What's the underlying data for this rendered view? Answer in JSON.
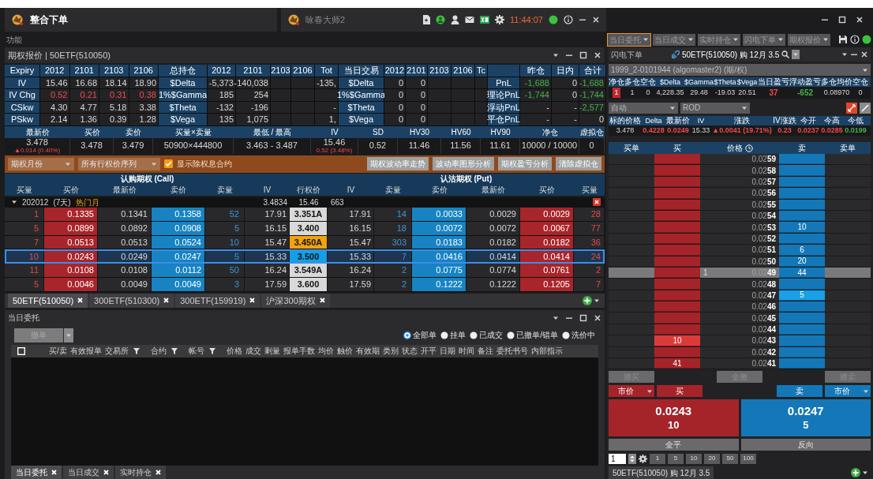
{
  "main_window": {
    "title": "整合下单",
    "menu": "功能"
  },
  "second_window": {
    "title": "咏春大师2",
    "clock": "11:44:07",
    "connected": true
  },
  "right_toolbar": {
    "connected": true,
    "items": [
      {
        "label": "当日委托",
        "selected": true
      },
      {
        "label": "当日成交",
        "selected": false
      },
      {
        "label": "实时持仓",
        "selected": false
      },
      {
        "label": "闪电下单",
        "selected": false
      },
      {
        "label": "期权报价",
        "selected": false
      }
    ]
  },
  "quote_panel": {
    "title": "期权报价 | 50ETF(510050)",
    "term": {
      "columns": [
        "Expiry",
        "2012",
        "2101",
        "2103",
        "2106"
      ],
      "rows": [
        {
          "label": "IV",
          "values": [
            "15.46",
            "16.68",
            "18.14",
            "18.90"
          ]
        },
        {
          "label": "IV Chg",
          "color": "#f04a4a",
          "values": [
            "0.52",
            "0.21",
            "0.31",
            "0.38"
          ]
        },
        {
          "label": "CSkw",
          "values": [
            "4.30",
            "4.77",
            "5.18",
            "3.38"
          ]
        },
        {
          "label": "PSkw",
          "values": [
            "2.14",
            "1.36",
            "0.39",
            "1.28"
          ]
        }
      ]
    },
    "holdings": {
      "columns": [
        "总持仓",
        "2012",
        "2101",
        "2103",
        "2106",
        "Tot"
      ],
      "rows": [
        {
          "label": "$Delta",
          "values": [
            {
              "kind": "value",
              "text": "-5,373"
            },
            {
              "kind": "value",
              "text": "-140,038"
            },
            {
              "kind": "blank"
            },
            {
              "kind": "blank"
            },
            {
              "kind": "value",
              "text": "-135,"
            }
          ]
        },
        {
          "label": "1%$Gamma",
          "values": [
            {
              "kind": "value",
              "text": "185"
            },
            {
              "kind": "value",
              "text": "254"
            },
            {
              "kind": "blank"
            },
            {
              "kind": "blank"
            },
            {
              "kind": "blank"
            }
          ]
        },
        {
          "label": "$Theta",
          "values": [
            {
              "kind": "value",
              "text": "-132"
            },
            {
              "kind": "value",
              "text": "-196"
            },
            {
              "kind": "blank"
            },
            {
              "kind": "blank"
            },
            {
              "kind": "value",
              "text": "-"
            }
          ]
        },
        {
          "label": "$Vega",
          "values": [
            {
              "kind": "value",
              "text": "135"
            },
            {
              "kind": "value",
              "text": "1,075"
            },
            {
              "kind": "blank"
            },
            {
              "kind": "blank"
            },
            {
              "kind": "value",
              "text": "1,"
            }
          ]
        }
      ]
    },
    "today": {
      "columns": [
        "当日交易",
        "2012",
        "2101",
        "2103",
        "2106",
        "Tc"
      ],
      "rows": [
        {
          "label": "$Delta",
          "values": [
            {
              "kind": "value",
              "text": "0"
            },
            {
              "kind": "value",
              "text": "0"
            },
            {
              "kind": "blank"
            },
            {
              "kind": "blank"
            },
            {
              "kind": "blank"
            }
          ]
        },
        {
          "label": "1%$Gamma",
          "values": [
            {
              "kind": "value",
              "text": "0"
            },
            {
              "kind": "value",
              "text": "0"
            },
            {
              "kind": "blank"
            },
            {
              "kind": "blank"
            },
            {
              "kind": "blank"
            }
          ]
        },
        {
          "label": "$Theta",
          "values": [
            {
              "kind": "value",
              "text": "0"
            },
            {
              "kind": "value",
              "text": "0"
            },
            {
              "kind": "blank"
            },
            {
              "kind": "blank"
            },
            {
              "kind": "blank"
            }
          ]
        },
        {
          "label": "$Vega",
          "values": [
            {
              "kind": "value",
              "text": "0"
            },
            {
              "kind": "value",
              "text": "0"
            },
            {
              "kind": "blank"
            },
            {
              "kind": "blank"
            },
            {
              "kind": "blank"
            }
          ]
        }
      ]
    },
    "pnl": {
      "columns": [
        "昨仓",
        "日内",
        "合计"
      ],
      "rows": [
        {
          "label": "PnL",
          "values": [
            {
              "kind": "value",
              "text": "-1,688",
              "color": "#47b04b"
            },
            {
              "kind": "value",
              "text": "0"
            },
            {
              "kind": "value",
              "text": "-1,688",
              "color": "#47b04b"
            }
          ]
        },
        {
          "label": "理论PnL",
          "values": [
            {
              "kind": "value",
              "text": "-1,744",
              "color": "#47b04b"
            },
            {
              "kind": "value",
              "text": "0"
            },
            {
              "kind": "value",
              "text": "-1,744",
              "color": "#47b04b"
            }
          ]
        },
        {
          "label": "浮动PnL",
          "values": [
            {
              "kind": "value",
              "text": "-"
            },
            {
              "kind": "value",
              "text": "-"
            },
            {
              "kind": "value",
              "text": "-2,577",
              "color": "#47b04b"
            }
          ]
        },
        {
          "label": "平仓PnL",
          "values": [
            {
              "kind": "value",
              "text": "-"
            },
            {
              "kind": "value",
              "text": "-"
            },
            {
              "kind": "value",
              "text": "0"
            }
          ]
        }
      ]
    },
    "underlying": [
      {
        "label": "最新价",
        "value": "3.478",
        "change": "▲0.014 (0.40%)"
      },
      {
        "label": "买价",
        "value": "3.478"
      },
      {
        "label": "卖价",
        "value": "3.479"
      },
      {
        "label": "买量×卖量",
        "value": "50900×444800"
      },
      {
        "label": "最低 / 最高",
        "value": "3.463 - 3.487"
      },
      {
        "label": "IV",
        "value": "15.46",
        "change": "0.52 (3.48%)"
      },
      {
        "label": "SD",
        "value": "0.52"
      },
      {
        "label": "HV30",
        "value": "11.46"
      },
      {
        "label": "HV60",
        "value": "11.56"
      },
      {
        "label": "HV90",
        "value": "11.61"
      },
      {
        "label": "净仓",
        "value": "10000 / 10000"
      },
      {
        "label": "虚拟仓",
        "value": "0"
      }
    ],
    "filters": {
      "month": "期权月份",
      "strikes": "所有行权价序列",
      "show_adjusted": {
        "label": "显示除权息合约",
        "checked": true
      }
    },
    "actions": [
      "期权波动率走势",
      "波动率图形分析",
      "期权盈亏分析",
      "清除虚拟仓"
    ],
    "chain": {
      "call_title": "认购期权 (Call)",
      "put_title": "认沽期权 (Put)",
      "columns": [
        "买量",
        "买价",
        "最新价",
        "卖价",
        "卖量",
        "IV",
        "行权价",
        "IV",
        "卖量",
        "卖价",
        "最新价",
        "买价",
        "买量"
      ],
      "expiry": {
        "month": "202012",
        "days": "(7天)",
        "tag": "热门月",
        "expanded": true,
        "values": [
          "3.4834",
          "15.46",
          "663"
        ]
      },
      "rows": [
        {
          "selected": false,
          "color": "#d9d9d9",
          "cells": [
            "1",
            "0.1335",
            "0.1341",
            "0.1358",
            "52",
            "17.91",
            "3.351A",
            "17.91",
            "14",
            "0.0033",
            "0.0029",
            "0.0029",
            "28"
          ]
        },
        {
          "selected": false,
          "color": "#d9d9d9",
          "cells": [
            "5",
            "0.0899",
            "0.0892",
            "0.0908",
            "5",
            "16.15",
            "3.400",
            "16.15",
            "18",
            "0.0072",
            "0.0072",
            "0.0067",
            "77"
          ]
        },
        {
          "selected": false,
          "color": "#f0a30a",
          "cells": [
            "7",
            "0.0513",
            "0.0513",
            "0.0524",
            "10",
            "15.47",
            "3.450A",
            "15.47",
            "303",
            "0.0183",
            "0.0182",
            "0.0182",
            "36"
          ]
        },
        {
          "selected": true,
          "color": "#14a0e6",
          "cells": [
            "10",
            "0.0243",
            "0.0249",
            "0.0247",
            "5",
            "15.33",
            "3.500",
            "15.33",
            "7",
            "0.0416",
            "0.0414",
            "0.0414",
            "24"
          ]
        },
        {
          "selected": false,
          "color": "#d9d9d9",
          "cells": [
            "11",
            "0.0108",
            "0.0108",
            "0.0112",
            "50",
            "16.24",
            "3.549A",
            "16.24",
            "2",
            "0.0775",
            "0.0774",
            "0.0761",
            "2"
          ]
        },
        {
          "selected": false,
          "color": "#d9d9d9",
          "cells": [
            "5",
            "0.0046",
            "0.0049",
            "0.0049",
            "3",
            "17.59",
            "3.600",
            "17.59",
            "2",
            "0.1222",
            "0.1222",
            "0.1205",
            "7"
          ]
        }
      ]
    },
    "tabs": [
      {
        "label": "50ETF(510050)",
        "selected": true
      },
      {
        "label": "300ETF(510300)",
        "selected": false
      },
      {
        "label": "300ETF(159919)",
        "selected": false
      },
      {
        "label": "沪深300期权",
        "selected": false
      }
    ]
  },
  "orders_panel": {
    "title": "当日委托",
    "cancel_button": {
      "label": "撤单",
      "disabled": true
    },
    "filters": [
      {
        "label": "全部单",
        "selected": true
      },
      {
        "label": "挂单",
        "selected": false
      },
      {
        "label": "已成交",
        "selected": false
      },
      {
        "label": "已撤单/错单",
        "selected": false
      },
      {
        "label": "洗价中",
        "selected": false
      }
    ],
    "select_all": false,
    "columns": [
      {
        "label": "买/卖",
        "filter": false
      },
      {
        "label": "有效报单",
        "filter": false
      },
      {
        "label": "交易所",
        "filter": true
      },
      {
        "label": "合约",
        "filter": true
      },
      {
        "label": "帐号",
        "filter": true
      },
      {
        "label": "价格",
        "filter": false
      },
      {
        "label": "成交",
        "filter": false
      },
      {
        "label": "剩量",
        "filter": false
      },
      {
        "label": "报单手数",
        "filter": false
      },
      {
        "label": "均价",
        "filter": false
      },
      {
        "label": "触价",
        "filter": false
      },
      {
        "label": "有效期",
        "filter": false
      },
      {
        "label": "类别",
        "filter": false
      },
      {
        "label": "状态",
        "filter": false
      },
      {
        "label": "开平",
        "filter": false
      },
      {
        "label": "日期",
        "filter": false
      },
      {
        "label": "时间",
        "filter": false
      },
      {
        "label": "备注",
        "filter": false
      },
      {
        "label": "委托书号",
        "filter": false
      },
      {
        "label": "内部指示",
        "filter": false
      }
    ],
    "tabs": [
      {
        "label": "当日委托",
        "selected": true
      },
      {
        "label": "当日成交",
        "selected": false
      },
      {
        "label": "实时持仓",
        "selected": false
      }
    ]
  },
  "flash_order": {
    "title": "闪电下单",
    "contract": "50ETF(510050) 购 12月 3.5",
    "account": "1999_2-0101944 (algomaster2) (期/权)",
    "position": {
      "columns": [
        "净仓",
        "多仓",
        "空仓",
        "$Delta",
        "$Gamma",
        "$Theta",
        "$Vega",
        "当日盈亏",
        "浮动盈亏",
        "多仓均价",
        "空仓"
      ],
      "values": [
        {
          "kind": "badge",
          "text": "1"
        },
        {
          "kind": "plain",
          "text": "1"
        },
        {
          "kind": "plain",
          "text": "0"
        },
        {
          "kind": "plain",
          "text": "4,228.35"
        },
        {
          "kind": "plain",
          "text": "29.48"
        },
        {
          "kind": "plain",
          "text": "-19.03"
        },
        {
          "kind": "plain",
          "text": "20.51"
        },
        {
          "kind": "plain",
          "text": "37",
          "color": "#f04a4a"
        },
        {
          "kind": "plain",
          "text": "-652",
          "color": "#47b04b"
        },
        {
          "kind": "plain",
          "text": "0.08970"
        },
        {
          "kind": "plain",
          "text": "0"
        }
      ]
    },
    "order_mode": "自动",
    "time_in_force": "ROD",
    "quote": {
      "columns": [
        "标的价格",
        "Delta",
        "最新价",
        "IV",
        "涨跌",
        "IV涨跌",
        "今开",
        "今高",
        "今低"
      ],
      "values": [
        {
          "text": "3.478"
        },
        {
          "text": "0.4228",
          "color": "#f04a4a"
        },
        {
          "text": "0.0249",
          "color": "#f04a4a"
        },
        {
          "text": "15.33"
        },
        {
          "text": "▲0.0041 (19.71%)",
          "color": "#f04a4a"
        },
        {
          "text": "0.23",
          "color": "#f04a4a"
        },
        {
          "text": "0.0237",
          "color": "#f04a4a"
        },
        {
          "text": "0.0285",
          "color": "#f04a4a"
        },
        {
          "text": "0.0199",
          "color": "#47b04b"
        }
      ]
    },
    "ladder": {
      "columns": [
        "买单",
        "买",
        "价格",
        "卖",
        "卖单"
      ],
      "rows": [
        {
          "price": "0.02**59**",
          "last": false,
          "best_bid": false,
          "best_ask": false
        },
        {
          "price": "0.02**58**",
          "last": false,
          "best_bid": false,
          "best_ask": false
        },
        {
          "price": "0.02**57**",
          "last": false,
          "best_bid": false,
          "best_ask": false
        },
        {
          "price": "0.02**56**",
          "last": false,
          "best_bid": false,
          "best_ask": false
        },
        {
          "price": "0.02**55**",
          "last": false,
          "best_bid": false,
          "best_ask": false
        },
        {
          "price": "0.02**54**",
          "last": false,
          "best_bid": false,
          "best_ask": false
        },
        {
          "price": "0.02**53**",
          "ask": "10",
          "last": false,
          "best_bid": false,
          "best_ask": false
        },
        {
          "price": "0.02**52**",
          "last": false,
          "best_bid": false,
          "best_ask": false
        },
        {
          "price": "0.02**51**",
          "ask": "6",
          "last": false,
          "best_bid": false,
          "best_ask": false
        },
        {
          "price": "0.02**50**",
          "ask": "20",
          "last": false,
          "best_bid": false,
          "best_ask": false
        },
        {
          "price": "0.02**49**",
          "ask": "44",
          "volume": "1",
          "last": true,
          "best_bid": false,
          "best_ask": false
        },
        {
          "price": "0.02**48**",
          "last": false,
          "best_bid": false,
          "best_ask": false
        },
        {
          "price": "0.02**47**",
          "ask": "5",
          "last": false,
          "best_bid": false,
          "best_ask": true
        },
        {
          "price": "0.02**46**",
          "last": false,
          "best_bid": false,
          "best_ask": false
        },
        {
          "price": "0.02**45**",
          "last": false,
          "best_bid": false,
          "best_ask": false
        },
        {
          "price": "0.02**44**",
          "last": false,
          "best_bid": false,
          "best_ask": false
        },
        {
          "price": "0.02**43**",
          "bid": "10",
          "last": false,
          "best_bid": true,
          "best_ask": false
        },
        {
          "price": "0.02**42**",
          "last": false,
          "best_bid": false,
          "best_ask": false
        },
        {
          "price": "0.02**41**",
          "bid": "41",
          "last": false,
          "best_bid": false,
          "best_ask": false
        }
      ]
    },
    "cancel_buttons": [
      {
        "label": "撤买",
        "disabled": true
      },
      {
        "label": "全撤",
        "disabled": true
      },
      {
        "label": "撤卖",
        "disabled": true
      }
    ],
    "buy": {
      "price_type": "市价",
      "label": "买",
      "price": "0.0243",
      "quantity": "10"
    },
    "sell": {
      "price_type": "市价",
      "label": "卖",
      "price": "0.0247",
      "quantity": "5"
    },
    "close_all": "全平",
    "reverse": "反向",
    "quantity": "1",
    "presets": [
      "1",
      "5",
      "10",
      "20",
      "50",
      "100"
    ],
    "tabs": [
      {
        "label": "50ETF(510050) 购 12月 3.5",
        "selected": true
      }
    ]
  }
}
